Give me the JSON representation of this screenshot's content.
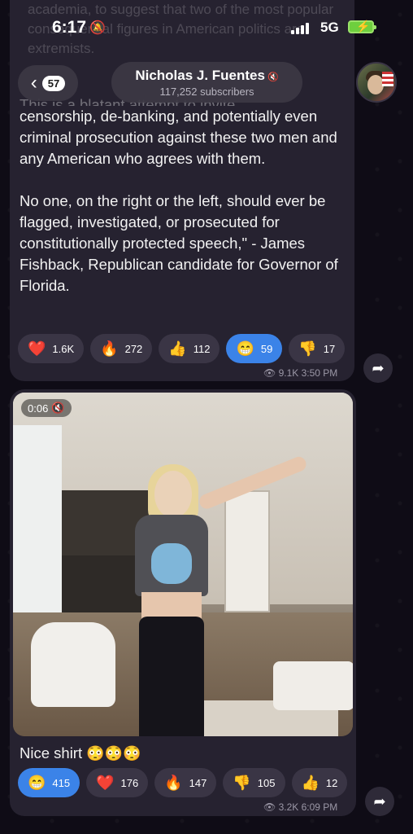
{
  "status_bar": {
    "time": "6:17",
    "network": "5G"
  },
  "background_text": "academia, to suggest that two of the most popular consequential figures in American politics are extremists.",
  "header": {
    "back_count": "57",
    "channel_name": "Nicholas J. Fuentes",
    "subscribers": "117,252 subscribers"
  },
  "message1": {
    "cut_line": "This is a blatant attempt to invite",
    "paragraph1": "censorship, de-banking, and potentially even criminal prosecution against these two men and any American who agrees with them.",
    "paragraph2": "No one, on the right or the left, should ever be flagged, investigated, or prosecuted for constitutionally protected speech,\" - James Fishback, Republican candidate for Governor of Florida.",
    "reactions": [
      {
        "emoji": "❤️",
        "count": "1.6K",
        "active": false
      },
      {
        "emoji": "🔥",
        "count": "272",
        "active": false
      },
      {
        "emoji": "👍",
        "count": "112",
        "active": false
      },
      {
        "emoji": "😁",
        "count": "59",
        "active": true
      },
      {
        "emoji": "👎",
        "count": "17",
        "active": false
      }
    ],
    "views": "9.1K",
    "time": "3:50 PM"
  },
  "message2": {
    "video_duration": "0:06",
    "caption": "Nice shirt",
    "caption_emojis": "😳😳😳",
    "reactions": [
      {
        "emoji": "😁",
        "count": "415",
        "active": true
      },
      {
        "emoji": "❤️",
        "count": "176",
        "active": false
      },
      {
        "emoji": "🔥",
        "count": "147",
        "active": false
      },
      {
        "emoji": "👎",
        "count": "105",
        "active": false
      },
      {
        "emoji": "👍",
        "count": "12",
        "active": false
      }
    ],
    "views": "3.2K",
    "time": "6:09 PM"
  },
  "colors": {
    "background": "#0f0c16",
    "bubble": "#262230",
    "reaction": "#3a3545",
    "reaction_active": "#3b83e8",
    "meta": "#9b97a6"
  }
}
